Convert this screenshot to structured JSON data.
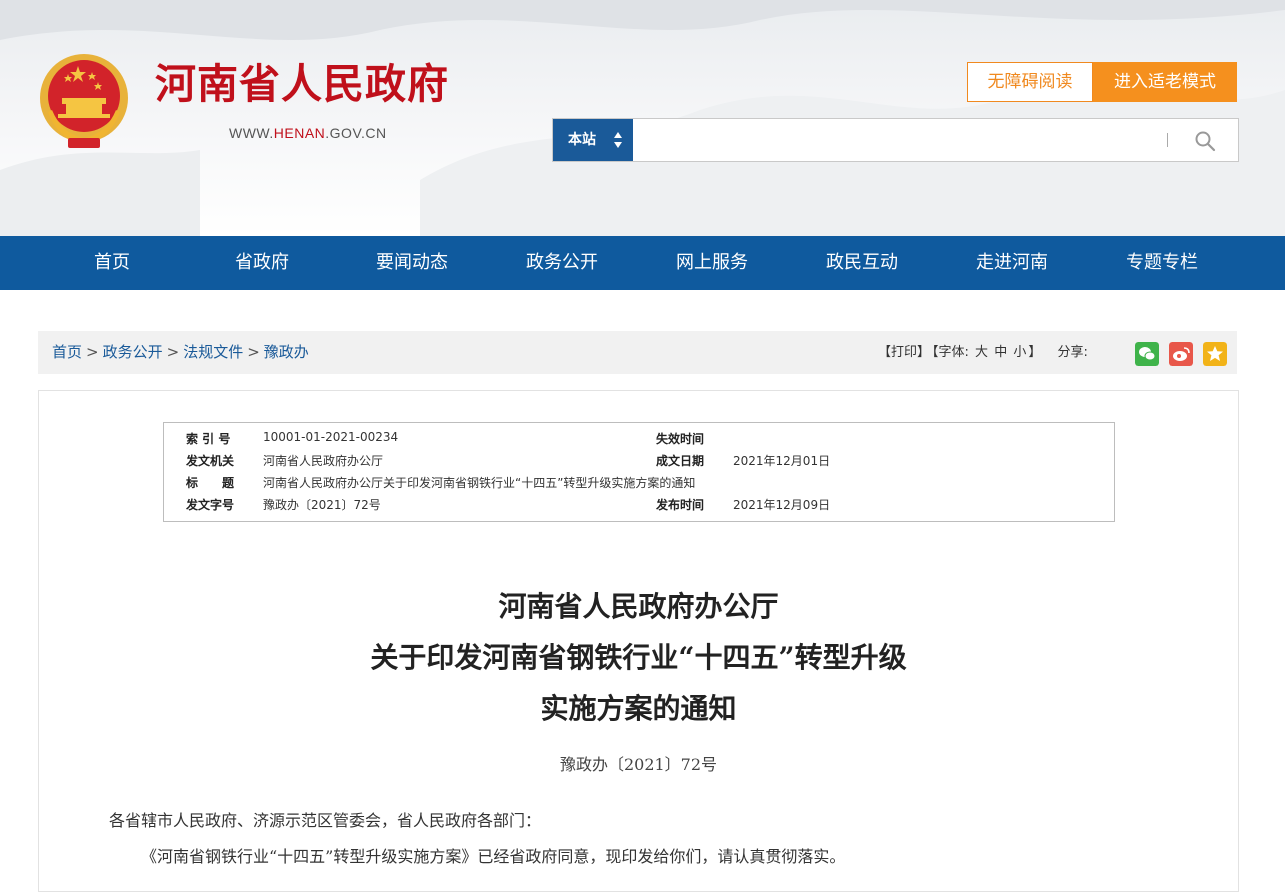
{
  "header": {
    "site_name": "河南省人民政府",
    "site_url_prefix": "WWW.",
    "site_url_highlight": "HENAN",
    "site_url_suffix": ".GOV.CN",
    "accessible_label": "无障碍阅读",
    "elder_mode_label": "进入适老模式",
    "search": {
      "scope_label": "本站",
      "placeholder": "",
      "value": ""
    },
    "icons": {
      "emblem": "national-emblem-icon",
      "search": "search-icon",
      "scope_arrows": "updown-arrows-icon"
    }
  },
  "nav": {
    "items": [
      "首页",
      "省政府",
      "要闻动态",
      "政务公开",
      "网上服务",
      "政民互动",
      "走进河南",
      "专题专栏"
    ]
  },
  "breadcrumb": {
    "items": [
      "首页",
      "政务公开",
      "法规文件",
      "豫政办"
    ],
    "separator": ">"
  },
  "tools": {
    "print_label": "【打印】",
    "font_prefix": "【字体:",
    "font_large": "大",
    "font_medium": "中",
    "font_small": "小",
    "font_suffix": "】",
    "share_label": "分享:",
    "share_icons": [
      "wechat-icon",
      "weibo-icon",
      "favorite-icon"
    ]
  },
  "meta": {
    "index_label": "索 引 号",
    "index_value": "10001-01-2021-00234",
    "expire_label": "失效时间",
    "expire_value": "",
    "issuer_label": "发文机关",
    "issuer_value": "河南省人民政府办公厅",
    "date_made_label": "成文日期",
    "date_made_value": "2021年12月01日",
    "title_label": "标　　题",
    "title_value": "河南省人民政府办公厅关于印发河南省钢铁行业“十四五”转型升级实施方案的通知",
    "doc_no_label": "发文字号",
    "doc_no_value": "豫政办〔2021〕72号",
    "publish_label": "发布时间",
    "publish_value": "2021年12月09日"
  },
  "document": {
    "title_line1": "河南省人民政府办公厅",
    "title_line2": "关于印发河南省钢铁行业“十四五”转型升级",
    "title_line3": "实施方案的通知",
    "doc_number": "豫政办〔2021〕72号",
    "salutation": "各省辖市人民政府、济源示范区管委会，省人民政府各部门：",
    "body_line1": "《河南省钢铁行业“十四五”转型升级实施方案》已经省政府同意，现印发给你们，请认真贯彻落实。"
  },
  "colors": {
    "brand_red": "#c0101b",
    "nav_blue": "#0f5a9e",
    "accent_orange": "#f5901e"
  }
}
